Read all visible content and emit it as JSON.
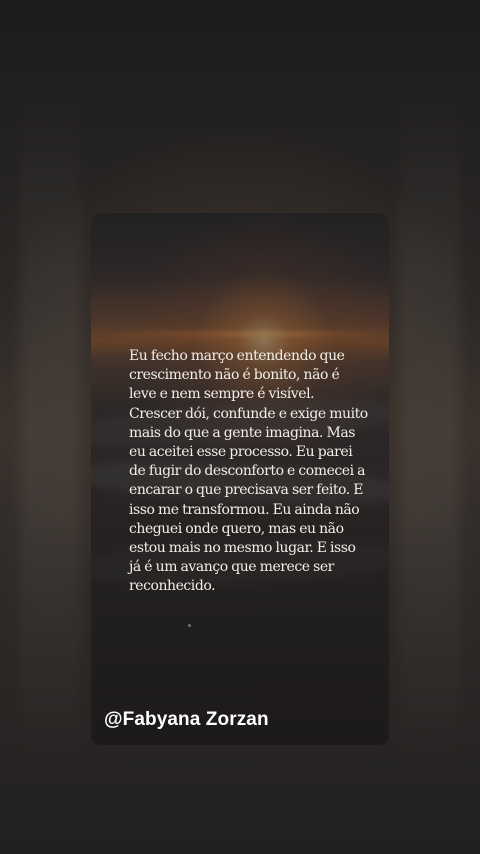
{
  "story": {
    "quote": "Eu fecho março entendendo que crescimento não é bonito, não é leve e nem sempre é visível. Crescer dói, confunde e exige muito mais do que a gente imagina. Mas eu aceitei esse processo. Eu parei de fugir do desconforto e comecei a encarar o que precisava ser feito. E isso me transformou. Eu ainda não cheguei onde quero, mas eu não estou mais no mesmo lugar. E isso já é um avanço que merece ser reconhecido.",
    "author_handle": "@Fabyana Zorzan"
  }
}
